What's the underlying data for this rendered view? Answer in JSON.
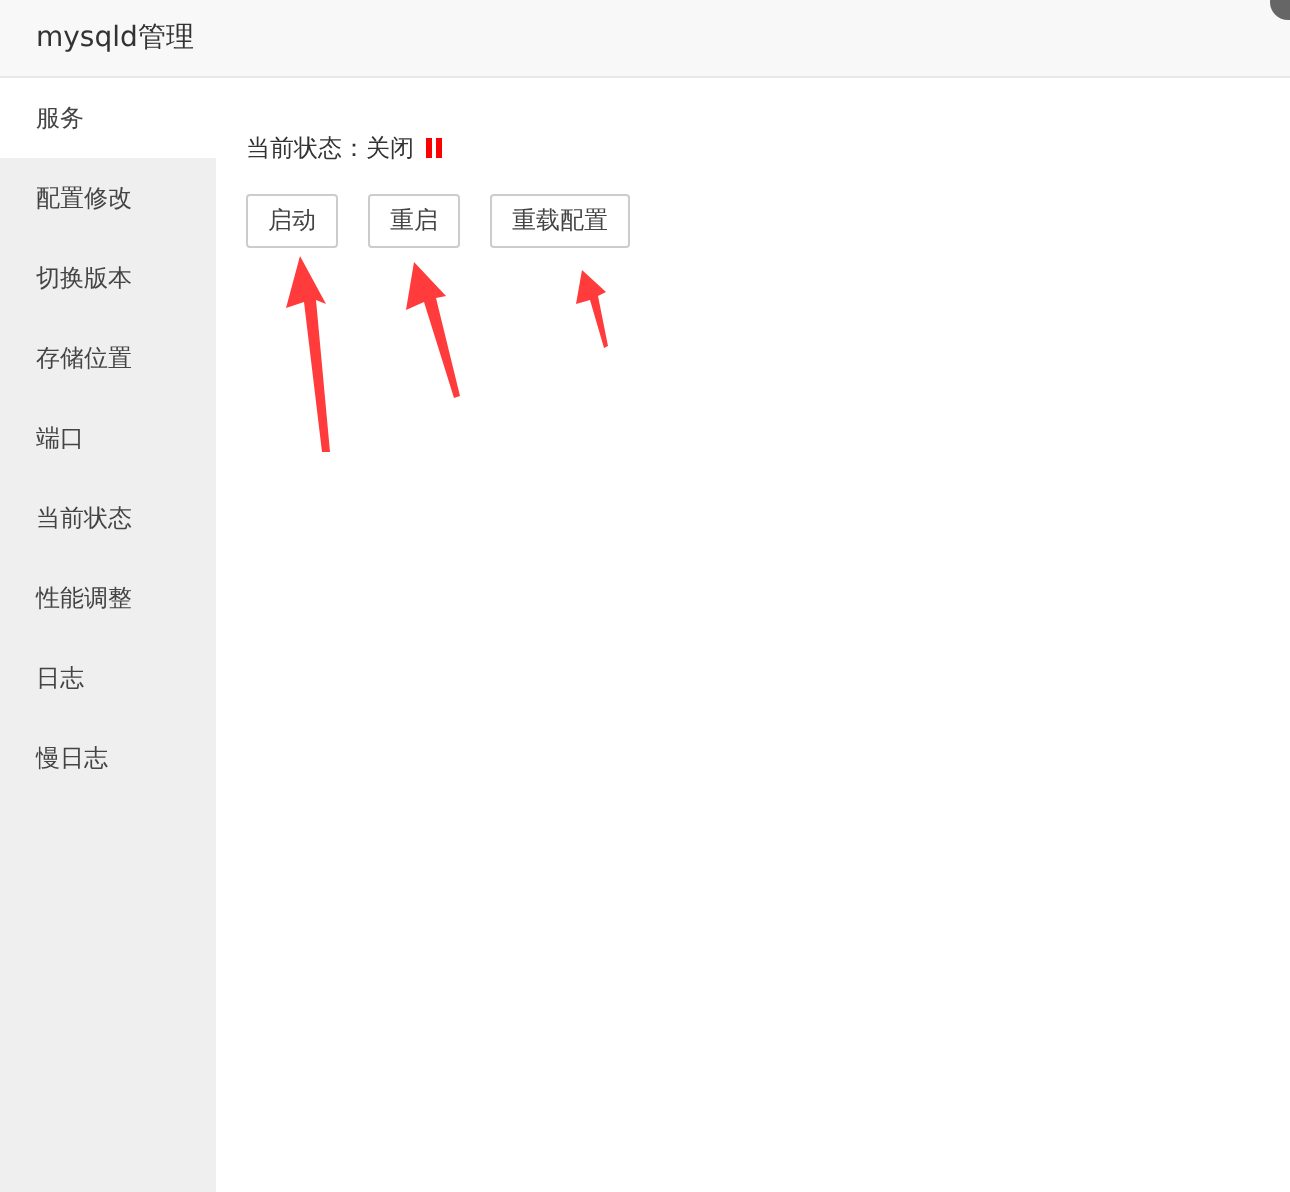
{
  "window": {
    "title": "mysqld管理"
  },
  "sidebar": {
    "items": [
      {
        "label": "服务",
        "selected": true
      },
      {
        "label": "配置修改",
        "selected": false
      },
      {
        "label": "切换版本",
        "selected": false
      },
      {
        "label": "存储位置",
        "selected": false
      },
      {
        "label": "端口",
        "selected": false
      },
      {
        "label": "当前状态",
        "selected": false
      },
      {
        "label": "性能调整",
        "selected": false
      },
      {
        "label": "日志",
        "selected": false
      },
      {
        "label": "慢日志",
        "selected": false
      }
    ]
  },
  "service": {
    "status": "当前状态：关闭",
    "running": false,
    "buttons": [
      "启动",
      "重启",
      "重载配置"
    ]
  }
}
